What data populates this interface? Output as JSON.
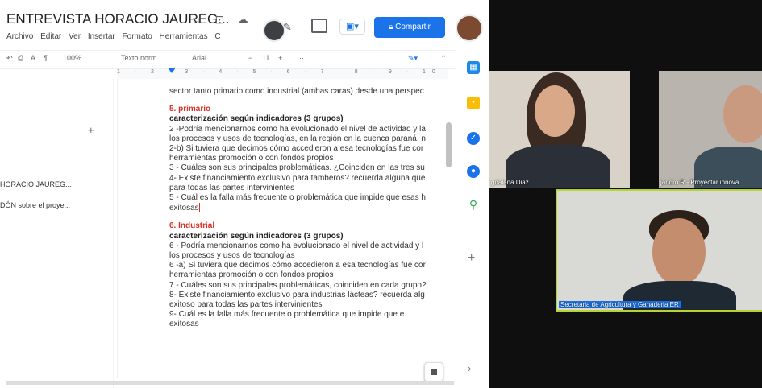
{
  "docs": {
    "title": "ENTREVISTA HORACIO JAUREG...",
    "title_icons": "☆ ⊡ ☁",
    "menus": [
      "Archivo",
      "Editar",
      "Ver",
      "Insertar",
      "Formato",
      "Herramientas",
      "C"
    ],
    "share_label": "Compartir",
    "meet_glyph": "▣▾",
    "toolbar": {
      "zoom": "100%",
      "style": "Texto norm...",
      "font": "Arial",
      "font_size": "11",
      "minus": "−",
      "plus": "+",
      "more": "⋯"
    },
    "ruler": "1 · 2 · 3 · 4 · 5 · 6 · 7 · 8 · 9 · 10 · 11 · 12",
    "outline": {
      "plus": "+",
      "items": [
        "HORACIO JAUREG...",
        "DÓN sobre el proye..."
      ]
    },
    "page_lines": [
      {
        "text": "sector tanto primario como industrial (ambas caras) desde una perspec",
        "style": "normal"
      },
      {
        "text": "5. primario",
        "style": "heading"
      },
      {
        "text": "caracterización según indicadores (3 grupos)",
        "style": "sub"
      },
      {
        "text": "2 -Podría mencionarnos como ha evolucionado el nivel de actividad y la",
        "style": "normal"
      },
      {
        "text": "los procesos y usos de tecnologías, en la región en la cuenca paraná, n",
        "style": "normal"
      },
      {
        "text": "2-b) Si tuviera que decimos cómo accedieron a esa tecnologías fue cor",
        "style": "normal"
      },
      {
        "text": "herramientas promoción o con fondos propios",
        "style": "normal"
      },
      {
        "text": "3 - Cuáles son sus principales problemáticas. ¿Coinciden en las tres su",
        "style": "normal"
      },
      {
        "text": "4- Existe financiamiento exclusivo para tamberos? recuerda alguna que",
        "style": "normal"
      },
      {
        "text": "para todas las partes intervinientes",
        "style": "normal"
      },
      {
        "text": "5 - Cuál es la falla más frecuente o problemática que impide que esas h",
        "style": "normal"
      },
      {
        "text": "exitosas",
        "style": "cursor"
      },
      {
        "text": "6. Industrial",
        "style": "heading"
      },
      {
        "text": "caracterización según indicadores (3 grupos)",
        "style": "sub"
      },
      {
        "text": "6 - Podría mencionarnos como ha evolucionado el nivel de actividad y l",
        "style": "normal"
      },
      {
        "text": "los procesos y usos de tecnologías",
        "style": "normal"
      },
      {
        "text": "6 -a) Si tuviera que decimos cómo accedieron a esa tecnologías fue cor",
        "style": "normal"
      },
      {
        "text": "herramientas promoción o con fondos propios",
        "style": "normal"
      },
      {
        "text": "7 - Cuáles son sus principales problemáticas, coinciden en cada grupo?",
        "style": "normal"
      },
      {
        "text": "8- Existe financiamiento exclusivo para industrias lácteas? recuerda alg",
        "style": "normal"
      },
      {
        "text": "exitoso para todas las partes intervinientes",
        "style": "normal"
      },
      {
        "text": "9- Cuál es la falla más frecuente o problemática que impide que e",
        "style": "normal"
      },
      {
        "text": "exitosas",
        "style": "normal"
      }
    ],
    "side_panel": {
      "plus": "+",
      "chevron": "›"
    }
  },
  "meet": {
    "participants": [
      {
        "label": "gdalena Diaz"
      },
      {
        "label": "jandro R - Proyectar innova"
      },
      {
        "label": "Secretaria de Agricultura y Ganaderia ER"
      }
    ]
  },
  "colors": {
    "accent": "#1a73e8",
    "heading": "#d93025",
    "active_speaker_border": "#b5d334"
  }
}
